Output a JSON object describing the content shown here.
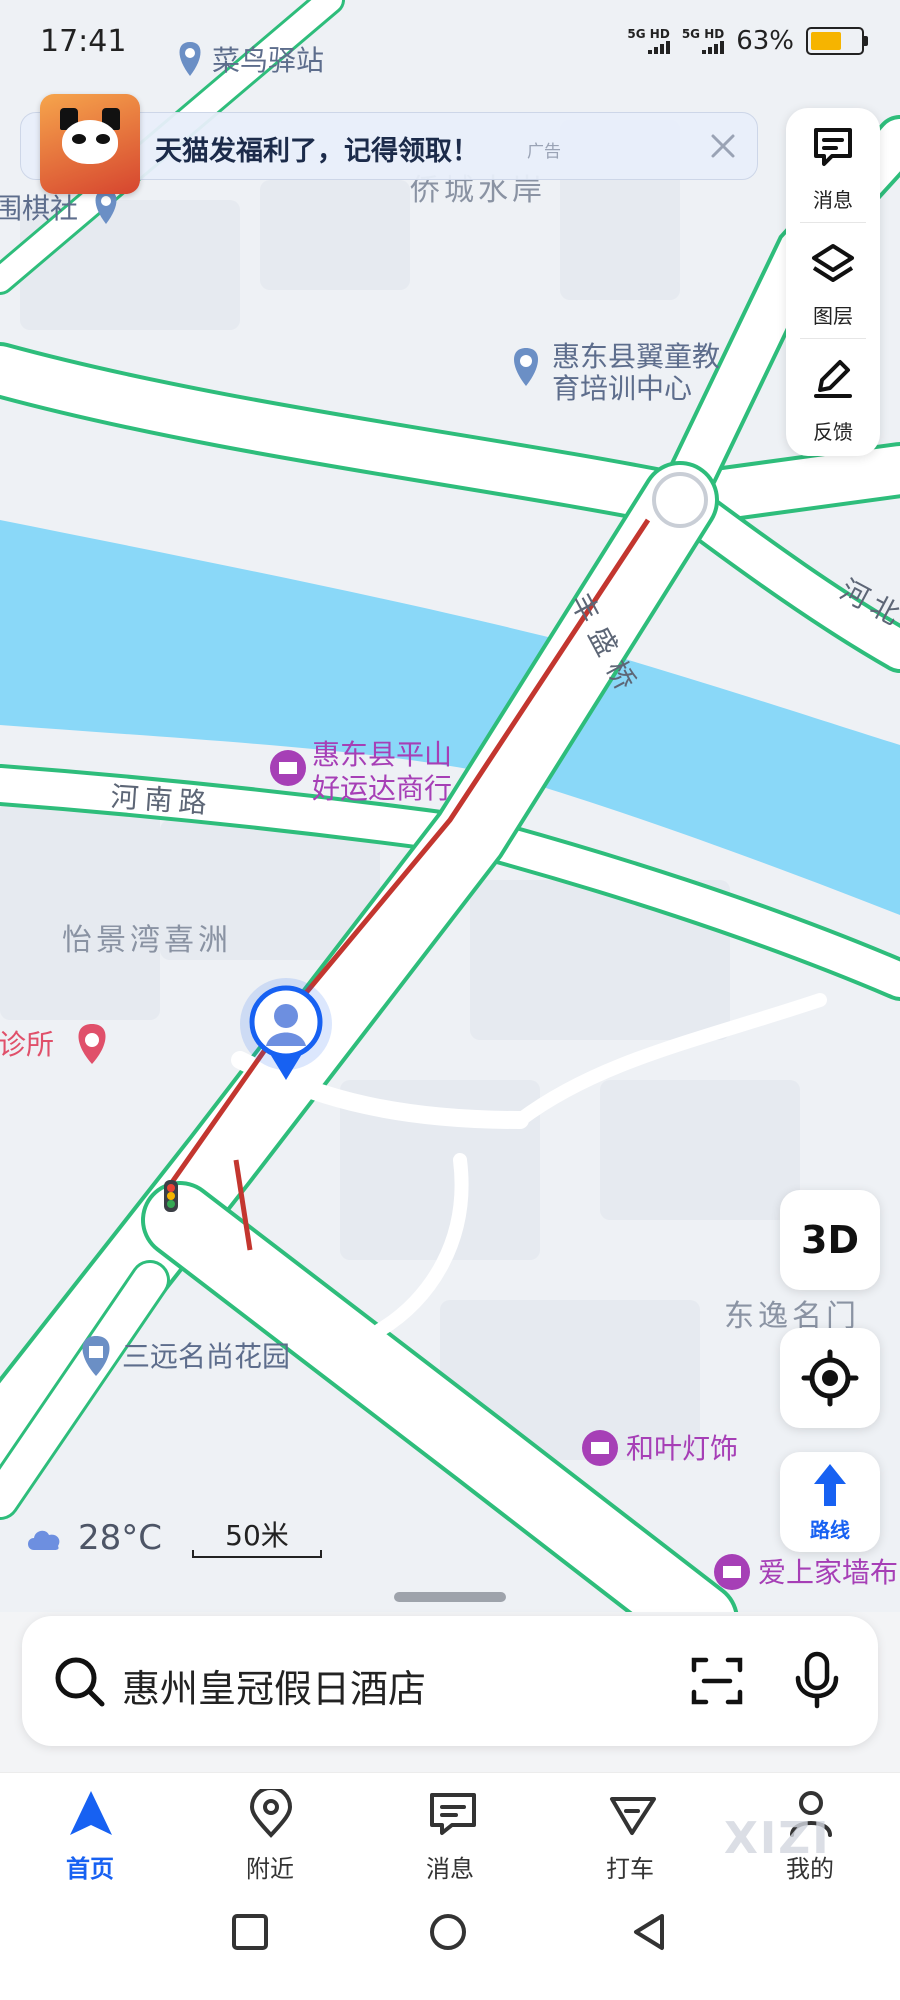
{
  "status_bar": {
    "time": "17:41",
    "network_1": "5G HD",
    "network_2": "5G HD",
    "battery_percent": "63%",
    "battery_level": 0.63
  },
  "ad": {
    "text": "天猫发福利了，记得领取！",
    "tag": "广告",
    "close_icon": "close-icon"
  },
  "map": {
    "road_labels": [
      {
        "text": "河南路"
      },
      {
        "text": "河北"
      },
      {
        "text": "丰盛桥"
      }
    ],
    "place_labels": [
      {
        "text": "菜鸟驿站",
        "icon": "pin-icon"
      },
      {
        "text": "围棋社",
        "icon": "pin-icon"
      },
      {
        "text": "侨城水岸",
        "icon": ""
      },
      {
        "text": "惠东县翼童教育培训中心",
        "line1": "惠东县翼童教",
        "line2": "育培训中心",
        "icon": "pin-icon"
      },
      {
        "text": "惠东县平山好运达商行",
        "line1": "惠东县平山",
        "line2": "好运达商行",
        "icon": "shop-icon"
      },
      {
        "text": "怡景湾喜洲",
        "icon": ""
      },
      {
        "text": "诊所",
        "icon": "clinic-icon"
      },
      {
        "text": "三远名尚花园",
        "icon": "residence-icon"
      },
      {
        "text": "东逸名门",
        "icon": ""
      },
      {
        "text": "和叶灯饰",
        "icon": "shop-icon"
      },
      {
        "text": "爱上家墙布",
        "icon": "shop-icon"
      }
    ],
    "colors": {
      "water": "#8ad8f8",
      "road_green": "#2ebd7b",
      "road_red": "#c3362f",
      "road_fill": "#ffffff",
      "land": "#eef1f5",
      "poi_purple": "#a63fb6",
      "poi_blue": "#6b8fc5",
      "poi_pink": "#e0506a"
    }
  },
  "tools": {
    "items": [
      {
        "label": "消息",
        "icon": "message-icon"
      },
      {
        "label": "图层",
        "icon": "layers-icon"
      },
      {
        "label": "反馈",
        "icon": "feedback-icon"
      }
    ]
  },
  "controls": {
    "three_d_label": "3D",
    "locate_icon": "locate-icon",
    "route_label": "路线",
    "route_icon": "route-arrow-icon"
  },
  "weather": {
    "icon": "cloud-icon",
    "temperature": "28°C"
  },
  "scale": {
    "label": "50米"
  },
  "search": {
    "text": "惠州皇冠假日酒店",
    "scan_icon": "scan-icon",
    "mic_icon": "mic-icon"
  },
  "tabs": [
    {
      "label": "首页",
      "icon": "home-nav-icon",
      "active": true
    },
    {
      "label": "附近",
      "icon": "nearby-pin-icon",
      "active": false
    },
    {
      "label": "消息",
      "icon": "message-icon",
      "active": false
    },
    {
      "label": "打车",
      "icon": "taxi-icon",
      "active": false
    },
    {
      "label": "我的",
      "icon": "profile-icon",
      "active": false
    }
  ],
  "watermark": "XIZI",
  "accent_color": "#1761f2"
}
